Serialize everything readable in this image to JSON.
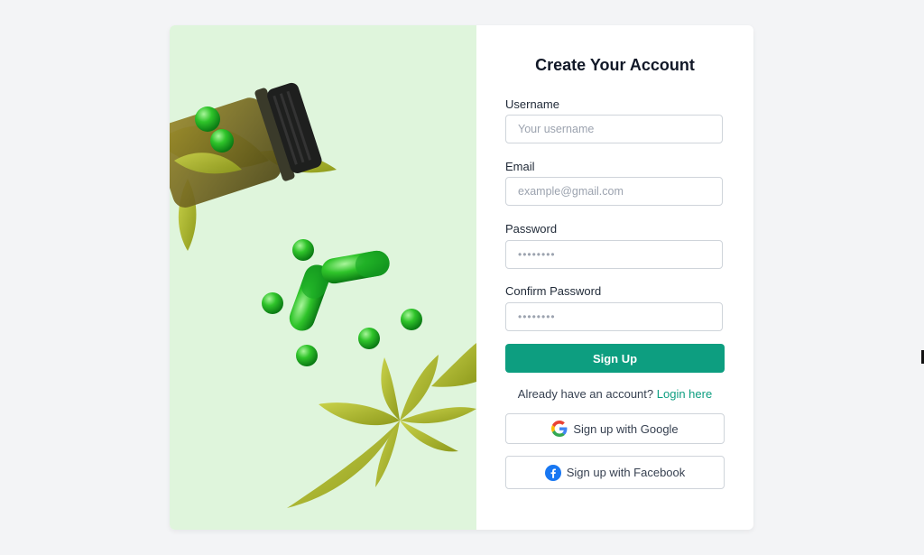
{
  "form": {
    "title": "Create Your Account",
    "username": {
      "label": "Username",
      "placeholder": "Your username"
    },
    "email": {
      "label": "Email",
      "placeholder": "example@gmail.com"
    },
    "password": {
      "label": "Password",
      "placeholder": "••••••••"
    },
    "confirm_password": {
      "label": "Confirm Password",
      "placeholder": "••••••••"
    },
    "submit_label": "Sign Up",
    "login_prompt": "Already have an account?",
    "login_link": "Login here",
    "google_label": "Sign up with Google",
    "facebook_label": "Sign up with Facebook"
  },
  "colors": {
    "accent": "#0d9e80",
    "hero_background": "#dff5dc",
    "page_background": "#f3f4f6"
  },
  "icons": {
    "google": "google-icon",
    "facebook": "facebook-icon"
  }
}
